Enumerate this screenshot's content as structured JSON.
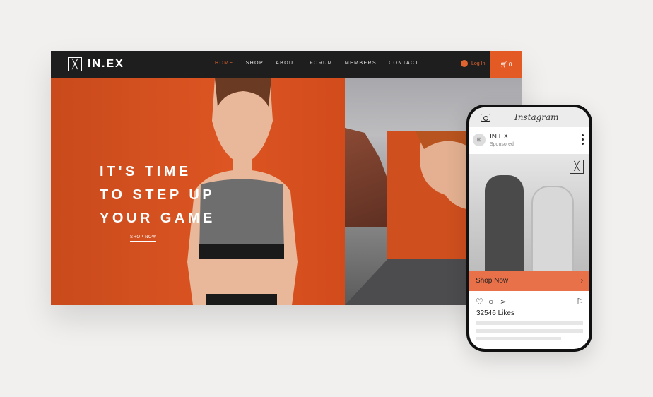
{
  "site": {
    "logo": "IN.EX",
    "logo_mark": "⨳",
    "nav": [
      "HOME",
      "SHOP",
      "ABOUT",
      "FORUM",
      "MEMBERS",
      "CONTACT"
    ],
    "login": "Log In",
    "cart_count": "0",
    "headline": [
      "IT'S TIME",
      "TO STEP UP",
      "YOUR GAME"
    ],
    "cta": "SHOP NOW",
    "accent": "#e35a24"
  },
  "instagram": {
    "app_title": "Instagram",
    "account": "IN.EX",
    "sponsored": "Sponsored",
    "shop_now": "Shop Now",
    "likes": "32546 Likes"
  }
}
